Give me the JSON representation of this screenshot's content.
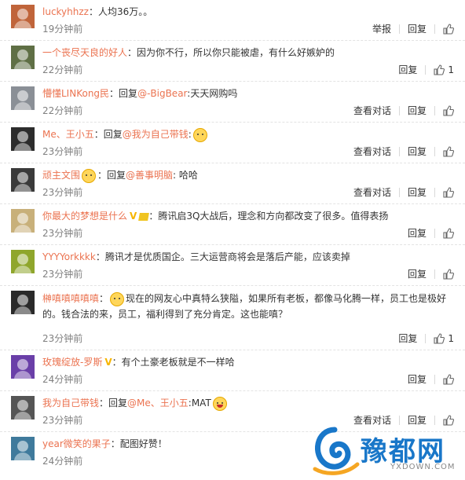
{
  "comments": [
    {
      "user": "luckyhhzz",
      "parts": [
        {
          "t": "：人均36万。。"
        }
      ],
      "time": "19分钟前",
      "actions": [
        "举报",
        "回复"
      ],
      "likes": "",
      "avatar": "#c0643a"
    },
    {
      "user": "一个丧尽天良的好人",
      "parts": [
        {
          "t": "：因为你不行，所以你只能被虐，有什么好嫉妒的"
        }
      ],
      "time": "22分钟前",
      "actions": [
        "回复"
      ],
      "likes": "1",
      "avatar": "#5f6f45"
    },
    {
      "user": "懵懂LINKong民",
      "parts": [
        {
          "t": "：回复"
        },
        {
          "m": "@-BigBear"
        },
        {
          "t": ":天天网购吗"
        }
      ],
      "time": "22分钟前",
      "actions": [
        "查看对话",
        "回复"
      ],
      "likes": "",
      "avatar": "#8a8f96"
    },
    {
      "user": "Me、王小五",
      "parts": [
        {
          "t": "：回复"
        },
        {
          "m": "@我为自己带钱"
        },
        {
          "t": ":"
        },
        {
          "e": "doge"
        }
      ],
      "time": "23分钟前",
      "actions": [
        "查看对话",
        "回复"
      ],
      "likes": "",
      "avatar": "#2c2c2c"
    },
    {
      "user": "顽主文围",
      "parts": [
        {
          "e": "vip"
        },
        {
          "t": "：回复"
        },
        {
          "m": "@善事明脑"
        },
        {
          "t": ": 哈哈"
        }
      ],
      "time": "23分钟前",
      "actions": [
        "查看对话",
        "回复"
      ],
      "likes": "",
      "avatar": "#3a3a3a"
    },
    {
      "user": "你最大的梦想是什么",
      "parts": [
        {
          "v": "V"
        },
        {
          "d": "1"
        },
        {
          "t": "：腾讯启3Q大战后，理念和方向都改变了很多。值得表扬"
        }
      ],
      "time": "23分钟前",
      "actions": [
        "回复"
      ],
      "likes": "",
      "avatar": "#c8b07a"
    },
    {
      "user": "YYYYorkkkk",
      "parts": [
        {
          "t": "：腾讯才是优质国企。三大运营商将会是落后产能，应该卖掉"
        }
      ],
      "time": "23分钟前",
      "actions": [
        "回复"
      ],
      "likes": "",
      "avatar": "#8fa62c"
    },
    {
      "user": "榊嗔嗔嗔嗔嗔",
      "parts": [
        {
          "t": "："
        },
        {
          "e": "doge"
        },
        {
          "t": "现在的网友心中真特么狭隘，如果所有老板，都像马化腾一样，员工也是极好的。钱合法的来，员工，福利得到了充分肯定。这也能嗔？"
        }
      ],
      "time": "23分钟前",
      "actions": [
        "回复"
      ],
      "likes": "1",
      "avatar": "#2a2a2a"
    },
    {
      "user": "玫瑰绽放-罗斯",
      "parts": [
        {
          "v": "V"
        },
        {
          "t": "：有个土豪老板就是不一样哈"
        }
      ],
      "time": "24分钟前",
      "actions": [
        "回复"
      ],
      "likes": "",
      "avatar": "#6a3fa8"
    },
    {
      "user": "我为自己带钱",
      "parts": [
        {
          "t": "：回复"
        },
        {
          "m": "@Me、王小五"
        },
        {
          "t": ":MAT"
        },
        {
          "e": "laugh"
        }
      ],
      "time": "23分钟前",
      "actions": [
        "查看对话",
        "回复"
      ],
      "likes": "",
      "avatar": "#555555"
    },
    {
      "user": "year微笑的果子",
      "parts": [
        {
          "t": "：配图好赞！"
        }
      ],
      "time": "24分钟前",
      "actions": [],
      "likes": "",
      "avatar": "#3f7a9c"
    }
  ],
  "watermark": {
    "title": "豫都网",
    "sub": "YXDOWN.COM"
  },
  "colors": {
    "username": "#eb7350",
    "time": "#808080",
    "brand": "#1977c9"
  }
}
